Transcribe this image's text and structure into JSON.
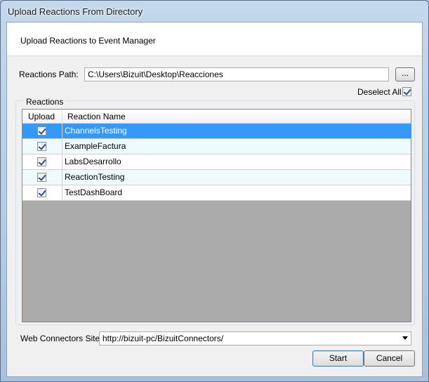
{
  "window": {
    "title": "Upload Reactions From Directory"
  },
  "header": {
    "text": "Upload Reactions to Event Manager"
  },
  "path": {
    "label": "Reactions Path:",
    "value": "C:\\Users\\Bizuit\\Desktop\\Reacciones",
    "browse_label": "..."
  },
  "deselect": {
    "label": "Deselect All",
    "checked": true
  },
  "reactions": {
    "group_title": "Reactions",
    "columns": [
      "Upload",
      "Reaction Name"
    ],
    "rows": [
      {
        "upload": true,
        "name": "ChannelsTesting",
        "selected": true
      },
      {
        "upload": true,
        "name": "ExampleFactura",
        "selected": false
      },
      {
        "upload": true,
        "name": "LabsDesarrollo",
        "selected": false
      },
      {
        "upload": true,
        "name": "ReactionTesting",
        "selected": false
      },
      {
        "upload": true,
        "name": "TestDashBoard",
        "selected": false
      }
    ]
  },
  "web_connectors": {
    "label": "Web Connectors Site:",
    "value": "http://bizuit-pc/BizuitConnectors/"
  },
  "buttons": {
    "start": "Start",
    "cancel": "Cancel"
  },
  "colors": {
    "selection": "#3399ff",
    "grid_empty": "#ababab",
    "alt_row": "#eefafc"
  }
}
